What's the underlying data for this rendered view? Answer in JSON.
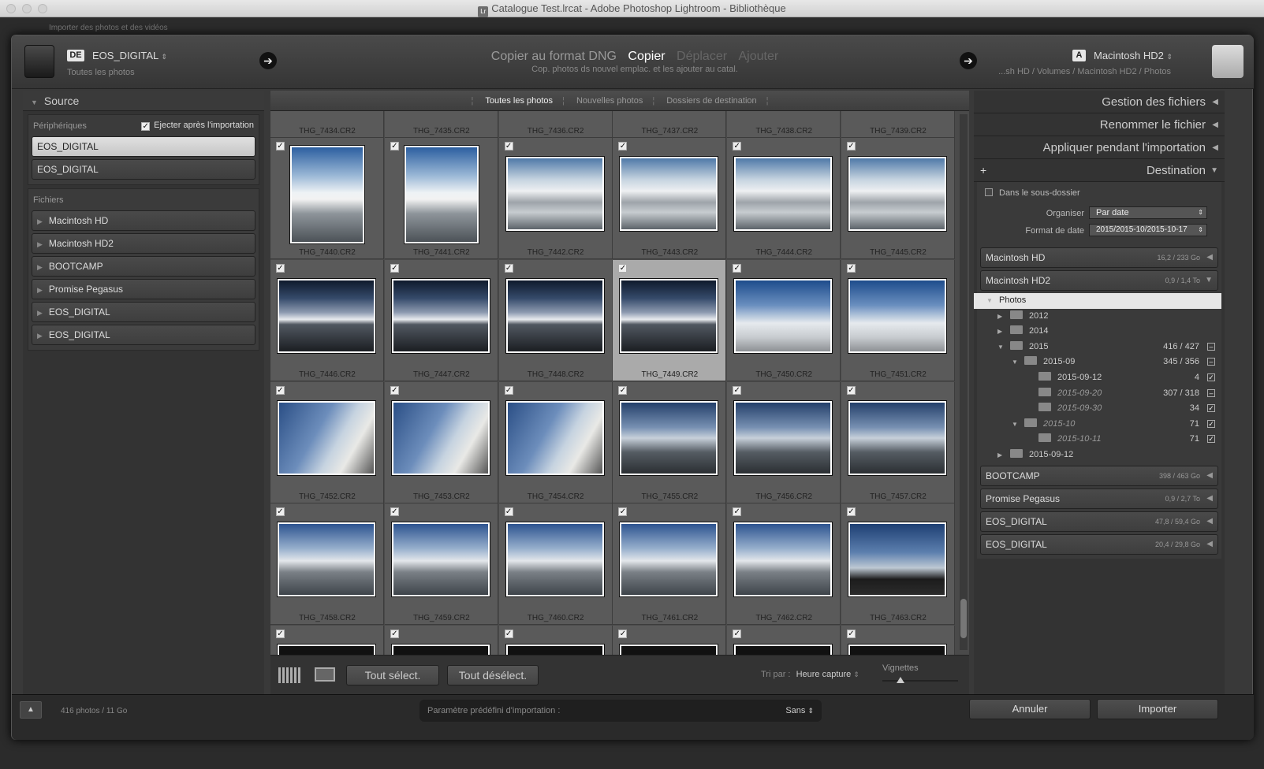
{
  "window": {
    "title": "Catalogue Test.lrcat - Adobe Photoshop Lightroom - Bibliothèque",
    "subtitle": "Importer des photos et des vidéos"
  },
  "header": {
    "source_badge": "DE",
    "source_name": "EOS_DIGITAL",
    "source_sub": "Toutes les photos",
    "modes": [
      "Copier au format DNG",
      "Copier",
      "Déplacer",
      "Ajouter"
    ],
    "active_mode": "Copier",
    "mode_desc": "Cop. photos ds nouvel emplac. et les ajouter au catal.",
    "dest_badge": "A",
    "dest_name": "Macintosh HD2",
    "dest_path": "...sh HD / Volumes / Macintosh HD2 / Photos"
  },
  "source_panel": {
    "title": "Source",
    "devices_label": "Périphériques",
    "eject_label": "Ejecter après l'importation",
    "devices": [
      "EOS_DIGITAL",
      "EOS_DIGITAL"
    ],
    "files_label": "Fichiers",
    "volumes": [
      "Macintosh HD",
      "Macintosh HD2",
      "BOOTCAMP",
      "Promise Pegasus",
      "EOS_DIGITAL",
      "EOS_DIGITAL"
    ]
  },
  "filter_bar": {
    "tabs": [
      "Toutes les photos",
      "Nouvelles photos",
      "Dossiers de destination"
    ]
  },
  "photos": [
    {
      "name": "THG_7434.CR2"
    },
    {
      "name": "THG_7435.CR2"
    },
    {
      "name": "THG_7436.CR2"
    },
    {
      "name": "THG_7437.CR2"
    },
    {
      "name": "THG_7438.CR2"
    },
    {
      "name": "THG_7439.CR2"
    },
    {
      "name": "THG_7440.CR2",
      "kind": "boat-portrait"
    },
    {
      "name": "THG_7441.CR2",
      "kind": "boat-portrait"
    },
    {
      "name": "THG_7442.CR2",
      "kind": "boat"
    },
    {
      "name": "THG_7443.CR2",
      "kind": "boat"
    },
    {
      "name": "THG_7444.CR2",
      "kind": "boat"
    },
    {
      "name": "THG_7445.CR2",
      "kind": "boat"
    },
    {
      "name": "THG_7446.CR2",
      "kind": "sunset"
    },
    {
      "name": "THG_7447.CR2",
      "kind": "sunset"
    },
    {
      "name": "THG_7448.CR2",
      "kind": "sunset"
    },
    {
      "name": "THG_7449.CR2",
      "kind": "sunset",
      "selected": true
    },
    {
      "name": "THG_7450.CR2",
      "kind": "cabin"
    },
    {
      "name": "THG_7451.CR2",
      "kind": "cabin"
    },
    {
      "name": "THG_7452.CR2",
      "kind": "sky-side"
    },
    {
      "name": "THG_7453.CR2",
      "kind": "sky-side"
    },
    {
      "name": "THG_7454.CR2",
      "kind": "sky-side"
    },
    {
      "name": "THG_7455.CR2",
      "kind": "deck"
    },
    {
      "name": "THG_7456.CR2",
      "kind": "deck"
    },
    {
      "name": "THG_7457.CR2",
      "kind": "deck"
    },
    {
      "name": "THG_7458.CR2",
      "kind": "deck2"
    },
    {
      "name": "THG_7459.CR2",
      "kind": "deck2"
    },
    {
      "name": "THG_7460.CR2",
      "kind": "deck2"
    },
    {
      "name": "THG_7461.CR2",
      "kind": "deck2"
    },
    {
      "name": "THG_7462.CR2",
      "kind": "deck2"
    },
    {
      "name": "THG_7463.CR2",
      "kind": "rail"
    },
    {
      "name": ""
    },
    {
      "name": ""
    },
    {
      "name": ""
    },
    {
      "name": ""
    },
    {
      "name": ""
    },
    {
      "name": ""
    }
  ],
  "toolbar": {
    "select_all": "Tout sélect.",
    "deselect_all": "Tout désélect.",
    "sort_label": "Tri par :",
    "sort_value": "Heure capture",
    "thumbs_label": "Vignettes"
  },
  "right_panel": {
    "sections": [
      "Gestion des fichiers",
      "Renommer le fichier",
      "Appliquer pendant l'importation",
      "Destination"
    ],
    "subfolder_label": "Dans le sous-dossier",
    "organize_label": "Organiser",
    "organize_value": "Par date",
    "date_format_label": "Format de date",
    "date_format_value": "2015/2015-10/2015-10-17",
    "volumes": [
      {
        "name": "Macintosh HD",
        "size": "16,2 / 233 Go"
      },
      {
        "name": "Macintosh HD2",
        "size": "0,9 / 1,4 To"
      }
    ],
    "tree": [
      {
        "label": "Photos",
        "level": 0,
        "selected": true
      },
      {
        "label": "2012",
        "level": 1
      },
      {
        "label": "2014",
        "level": 1
      },
      {
        "label": "2015",
        "level": 1,
        "count": "416 / 427",
        "mark": "–",
        "open": true
      },
      {
        "label": "2015-09",
        "level": 2,
        "count": "345 / 356",
        "mark": "–",
        "open": true
      },
      {
        "label": "2015-09-12",
        "level": 3,
        "count": "4",
        "mark": "✓"
      },
      {
        "label": "2015-09-20",
        "level": 3,
        "count": "307 / 318",
        "mark": "–",
        "italic": true
      },
      {
        "label": "2015-09-30",
        "level": 3,
        "count": "34",
        "mark": "✓",
        "italic": true
      },
      {
        "label": "2015-10",
        "level": 2,
        "count": "71",
        "mark": "✓",
        "italic": true,
        "open": true
      },
      {
        "label": "2015-10-11",
        "level": 3,
        "count": "71",
        "mark": "✓",
        "italic": true
      },
      {
        "label": "2015-09-12",
        "level": 1
      }
    ],
    "volumes2": [
      {
        "name": "BOOTCAMP",
        "size": "398 / 463 Go"
      },
      {
        "name": "Promise Pegasus",
        "size": "0,9 / 2,7 To"
      },
      {
        "name": "EOS_DIGITAL",
        "size": "47,8 / 59,4 Go"
      },
      {
        "name": "EOS_DIGITAL",
        "size": "20,4 / 29,8 Go"
      }
    ]
  },
  "footer": {
    "summary": "416 photos / 11 Go",
    "cancel": "Annuler",
    "import": "Importer",
    "preset_label": "Paramètre prédéfini d'importation :",
    "preset_value": "Sans"
  }
}
